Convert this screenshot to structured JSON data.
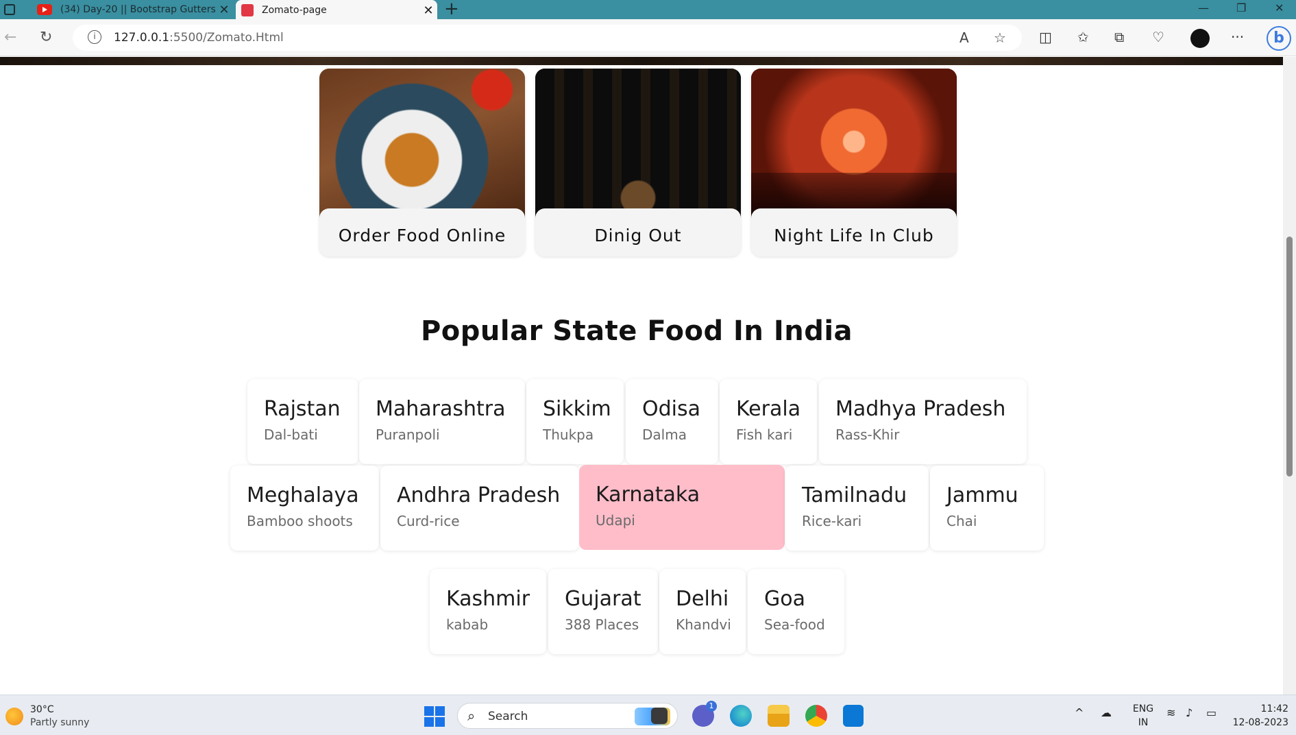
{
  "browser": {
    "tabs": [
      {
        "title": "(34) Day-20 || Bootstrap Gutters",
        "favicon": "youtube-icon",
        "active": false
      },
      {
        "title": "Zomato-page",
        "favicon": "zomato-icon",
        "active": true
      }
    ],
    "url_host": "127.0.0.1",
    "url_rest": ":5500/Zomato.Html"
  },
  "categories": [
    {
      "label": "Order Food Online"
    },
    {
      "label": "Dinig Out"
    },
    {
      "label": "Night Life In Club"
    }
  ],
  "section_title": "Popular State Food In India",
  "states": [
    {
      "name": "Rajstan",
      "food": "Dal-bati"
    },
    {
      "name": "Maharashtra",
      "food": "Puranpoli"
    },
    {
      "name": "Sikkim",
      "food": "Thukpa"
    },
    {
      "name": "Odisa",
      "food": "Dalma"
    },
    {
      "name": "Kerala",
      "food": "Fish kari"
    },
    {
      "name": "Madhya Pradesh",
      "food": "Rass-Khir"
    },
    {
      "name": "Meghalaya",
      "food": "Bamboo shoots"
    },
    {
      "name": "Andhra Pradesh",
      "food": "Curd-rice"
    },
    {
      "name": "Karnataka",
      "food": "Udapi"
    },
    {
      "name": "Tamilnadu",
      "food": "Rice-kari"
    },
    {
      "name": "Jammu",
      "food": "Chai"
    },
    {
      "name": "Kashmir",
      "food": "kabab"
    },
    {
      "name": "Gujarat",
      "food": "388 Places"
    },
    {
      "name": "Delhi",
      "food": "Khandvi"
    },
    {
      "name": "Goa",
      "food": "Sea-food"
    }
  ],
  "highlight_color": "#ffbdc9",
  "taskbar": {
    "temperature": "30°C",
    "weather": "Partly sunny",
    "search_placeholder": "Search",
    "chat_badge": "1",
    "lang_1": "ENG",
    "lang_2": "IN",
    "time": "11:42",
    "date": "12-08-2023"
  }
}
